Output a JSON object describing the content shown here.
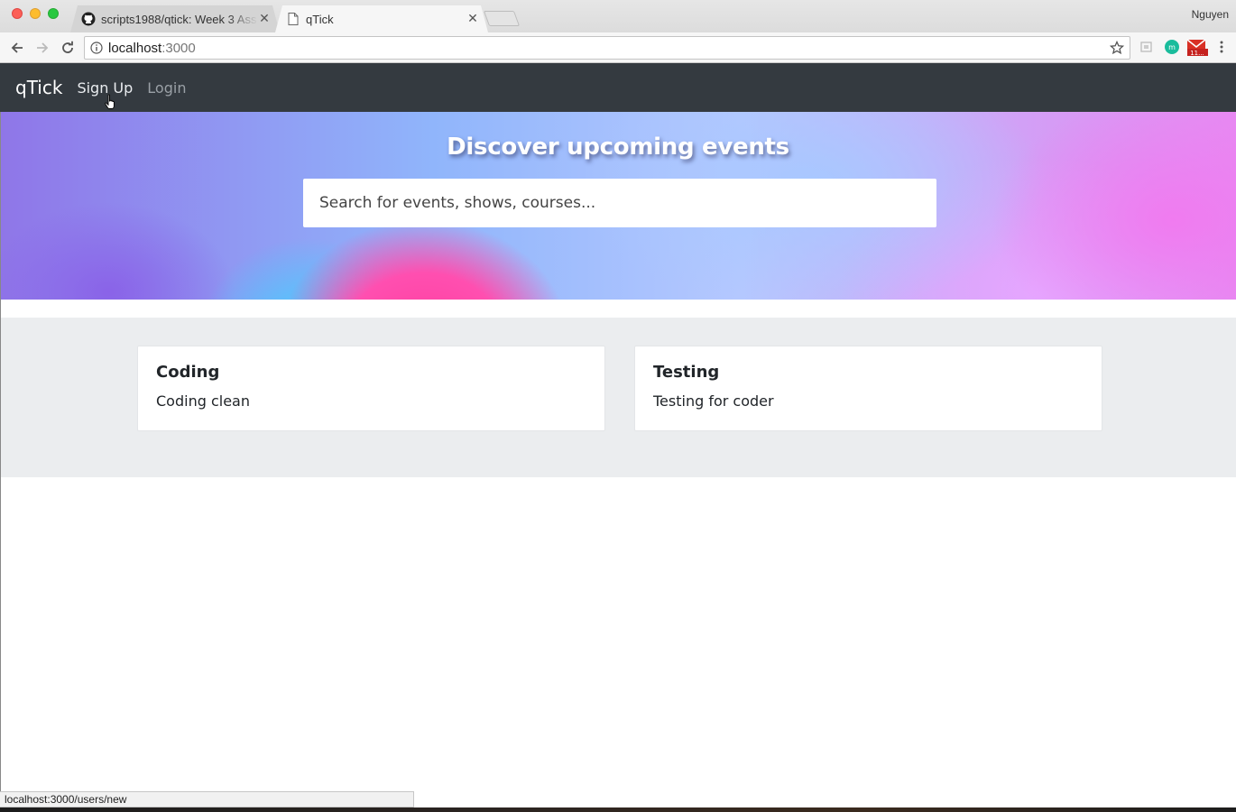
{
  "browser": {
    "tabs": [
      {
        "title": "scripts1988/qtick: Week 3 Ass",
        "icon": "github-icon",
        "active": false
      },
      {
        "title": "qTick",
        "icon": "page-icon",
        "active": true
      }
    ],
    "profile_name": "Nguyen",
    "url": {
      "host": "localhost",
      "port": ":3000"
    },
    "status_url": "localhost:3000/users/new"
  },
  "navbar": {
    "brand": "qTick",
    "links": [
      {
        "label": "Sign Up",
        "state": "hover"
      },
      {
        "label": "Login",
        "state": "muted"
      }
    ]
  },
  "hero": {
    "title": "Discover upcoming events",
    "search_placeholder": "Search for events, shows, courses..."
  },
  "events": [
    {
      "title": "Coding",
      "description": "Coding clean"
    },
    {
      "title": "Testing",
      "description": "Testing for coder"
    }
  ],
  "colors": {
    "navbar_bg": "#343a40",
    "events_bg": "#ebedef",
    "accent_pink": "#ff4fb0"
  }
}
